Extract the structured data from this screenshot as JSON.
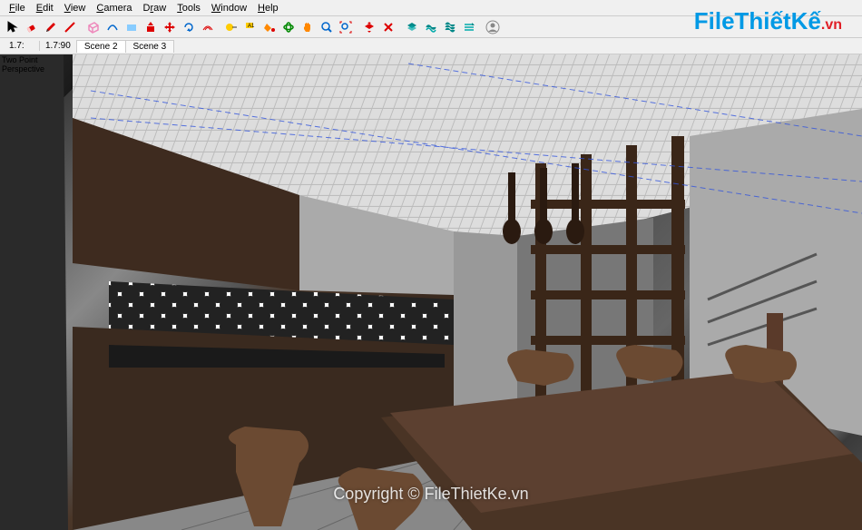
{
  "menu": {
    "file": "File",
    "edit": "Edit",
    "view": "View",
    "camera": "Camera",
    "draw": "Draw",
    "tools": "Tools",
    "window": "Window",
    "help": "Help"
  },
  "toolbar": {
    "select": "select",
    "eraser": "eraser",
    "pencil": "pencil",
    "paint": "paint-bucket",
    "rect": "rectangle",
    "circle": "circle",
    "arc": "arc",
    "pushpull": "push-pull",
    "move": "move",
    "rotate": "rotate",
    "scale": "scale",
    "offset": "offset",
    "tape": "tape-measure",
    "text": "text",
    "dim": "dimension",
    "orbit": "orbit",
    "pan": "pan",
    "zoom": "zoom",
    "zoomext": "zoom-extents",
    "undo": "undo",
    "redo": "redo",
    "section": "section",
    "layers": "layers",
    "styles": "styles",
    "outliner": "outliner",
    "shadows": "shadows",
    "user": "user-profile"
  },
  "measurements": {
    "field1": "1.7:",
    "field2": "1.7:90"
  },
  "scenes": {
    "s2": "Scene 2",
    "s3": "Scene 3"
  },
  "viewport": {
    "line1": "Two Point",
    "line2": "Perspective"
  },
  "watermark": {
    "part1": "FileThiếtKế",
    "part2": ".vn"
  },
  "copyright": "Copyright © FileThietKe.vn"
}
